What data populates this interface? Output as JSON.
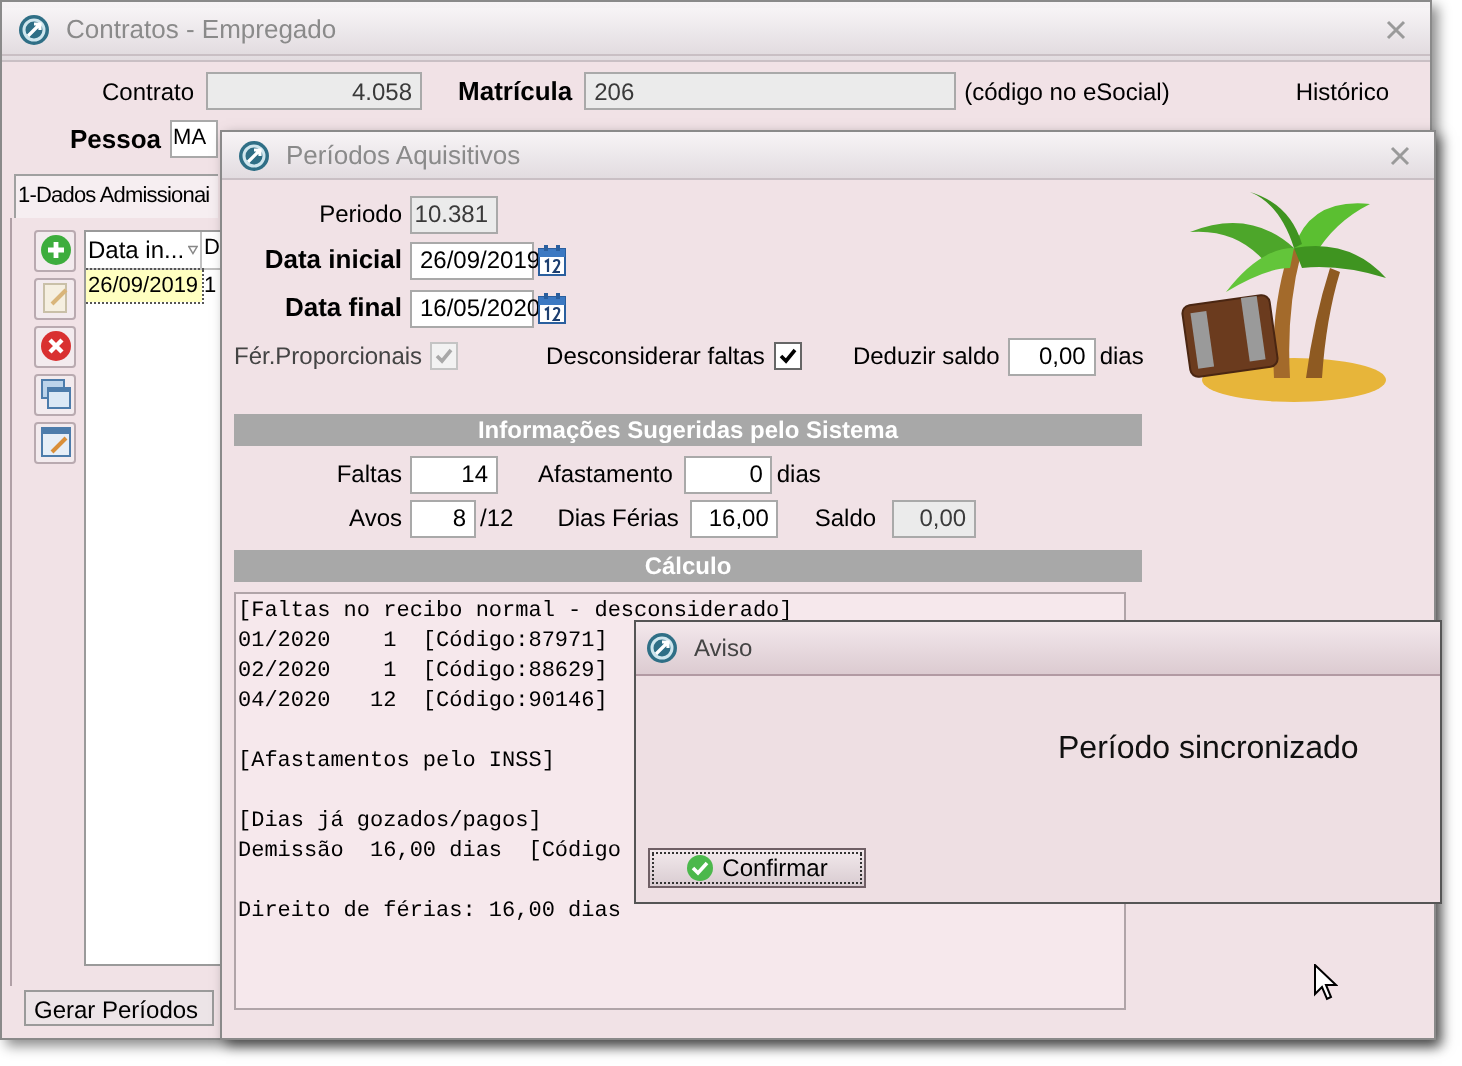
{
  "main_window": {
    "title": "Contratos - Empregado",
    "contrato": {
      "label": "Contrato",
      "value": "4.058"
    },
    "matricula": {
      "label": "Matrícula",
      "value": "206",
      "note": "(código no eSocial)"
    },
    "historico": "Histórico",
    "pessoa": {
      "label": "Pessoa",
      "value": "MA"
    },
    "tab": {
      "label": "1-Dados Admissionai"
    },
    "table": {
      "columns": [
        "Data in...",
        "D"
      ],
      "rows": [
        {
          "cells": [
            "26/09/2019",
            "1"
          ],
          "selected": true
        }
      ]
    },
    "button": "Gerar Períodos"
  },
  "periods_window": {
    "title": "Períodos Aquisitivos",
    "periodo": {
      "label": "Periodo",
      "value": "10.381"
    },
    "data_inicial": {
      "label": "Data inicial",
      "value": "26/09/2019"
    },
    "data_final": {
      "label": "Data final",
      "value": "16/05/2020"
    },
    "ferias_proporcionais": {
      "label": "Fér.Proporcionais",
      "checked": true,
      "disabled": true
    },
    "desconsiderar_faltas": {
      "label": "Desconsiderar faltas",
      "checked": true,
      "disabled": false
    },
    "deduzir_saldo": {
      "label": "Deduzir saldo",
      "value": "0,00",
      "unit": "dias"
    },
    "section_1": "Informações Sugeridas pelo Sistema",
    "faltas": {
      "label": "Faltas",
      "value": "14"
    },
    "afastamento": {
      "label": "Afastamento",
      "value": "0",
      "unit": "dias"
    },
    "avos": {
      "label": "Avos",
      "value": "8",
      "unit": "/12"
    },
    "dias_ferias": {
      "label": "Dias Férias",
      "value": "16,00"
    },
    "saldo": {
      "label": "Saldo",
      "value": "0,00"
    },
    "section_2": "Cálculo",
    "calculo": [
      [
        "[Faltas no recibo normal - desconsiderado]",
        "01/2020    1  [Código:87971]",
        "02/2020    1  [Código:88629]",
        "04/2020   12  [Código:90146]"
      ],
      [
        "[Afastamentos pelo INSS]"
      ],
      [
        "[Dias já gozados/pagos]",
        "Demissão  16,00 dias  [Código"
      ],
      [
        "Direito de férias: 16,00 dias"
      ]
    ]
  },
  "dialog": {
    "title": "Aviso",
    "message": "Período sincronizado",
    "button": "Confirmar"
  }
}
